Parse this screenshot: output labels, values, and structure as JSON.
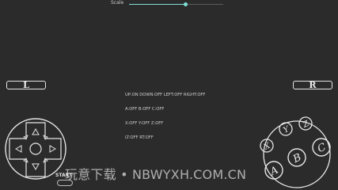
{
  "scale": {
    "label": "Scale",
    "value_fraction": 0.6
  },
  "shoulders": {
    "left": "L",
    "right": "R"
  },
  "status_lines": [
    "UP:ON DOWN:OFF LEFT:OFF RIGHT:OFF",
    "A:OFF B:OFF C:OFF",
    "X:OFF Y:OFF Z:OFF",
    "LT:OFF RT:OFF"
  ],
  "face_buttons": {
    "x": "X",
    "y": "Y",
    "z": "Z",
    "a": "A",
    "b": "B",
    "c": "C"
  },
  "start": {
    "label": "START"
  },
  "watermark": "玩意下载 • NBWYXH.COM.CN",
  "colors": {
    "background": "#2b2b2b",
    "accent": "#7fe0d6",
    "control_outline": "#e6e6e6"
  }
}
